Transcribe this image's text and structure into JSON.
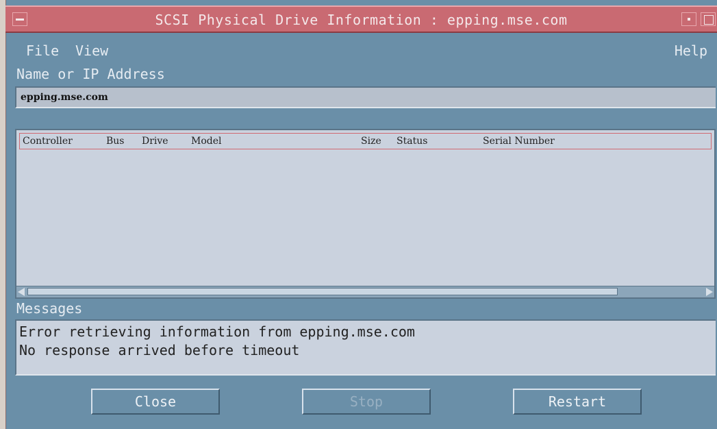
{
  "window": {
    "title": "SCSI Physical Drive Information : epping.mse.com"
  },
  "menubar": {
    "file": "File",
    "view": "View",
    "help": "Help"
  },
  "address": {
    "label": "Name or IP Address",
    "value": "epping.mse.com"
  },
  "drive_table": {
    "columns": [
      "Controller",
      "Bus",
      "Drive",
      "Model",
      "Size",
      "Status",
      "Serial Number"
    ],
    "rows": []
  },
  "messages": {
    "label": "Messages",
    "lines": [
      "Error retrieving information from epping.mse.com",
      "No response arrived before timeout"
    ]
  },
  "buttons": {
    "close": "Close",
    "stop": "Stop",
    "restart": "Restart"
  }
}
